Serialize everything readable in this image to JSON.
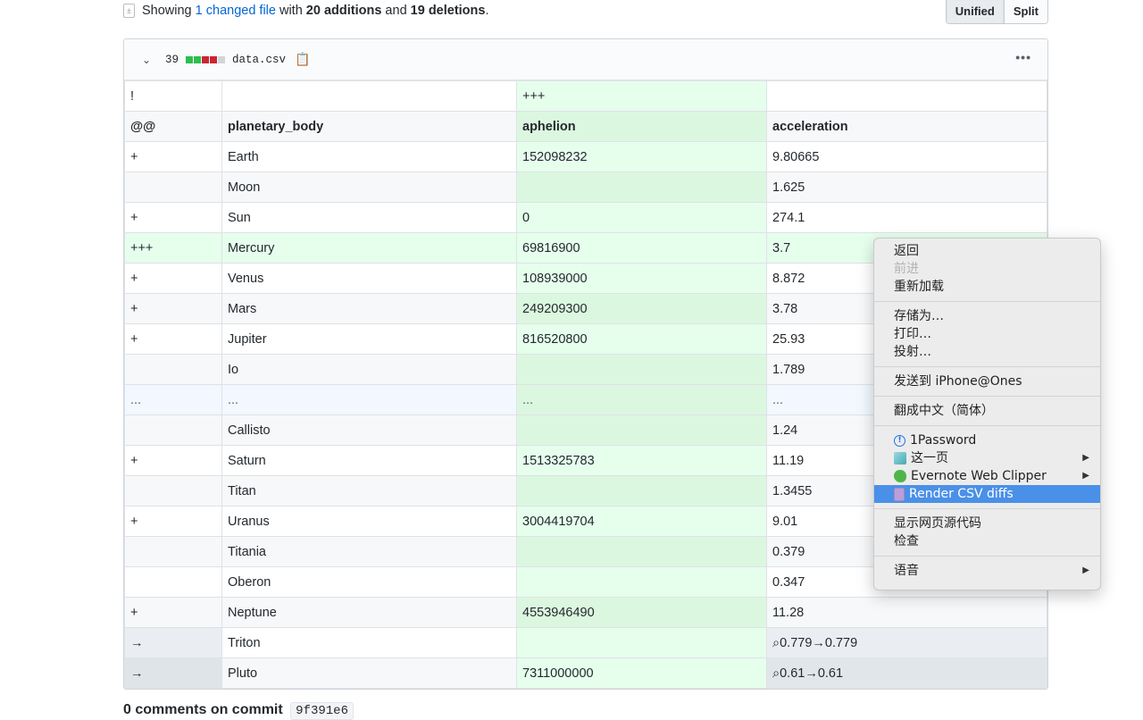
{
  "toc": {
    "showing": "Showing ",
    "changed_files_link": "1 changed file",
    "with": " with ",
    "additions": "20 additions",
    "and": " and ",
    "deletions": "19 deletions",
    "period": "."
  },
  "view_toggle": {
    "unified": "Unified",
    "split": "Split",
    "selected": "Unified"
  },
  "file": {
    "change_count": "39",
    "diffstat": [
      "added",
      "added",
      "deleted",
      "deleted",
      "neutral"
    ],
    "diffstat_colors": {
      "added": "#2cbe4e",
      "deleted": "#cb2431",
      "neutral": "#d1d5da"
    },
    "name": "data.csv",
    "more_label": "•••"
  },
  "table": {
    "added_column_index": 2,
    "rows": [
      {
        "type": "odd",
        "cells": [
          "!",
          "",
          "+++",
          ""
        ]
      },
      {
        "type": "hdr",
        "cells": [
          "@@",
          "planetary_body",
          "aphelion",
          "acceleration"
        ]
      },
      {
        "type": "odd",
        "cells": [
          "+",
          "Earth",
          "152098232",
          "9.80665"
        ]
      },
      {
        "type": "even",
        "cells": [
          "",
          "Moon",
          "",
          "1.625"
        ]
      },
      {
        "type": "odd",
        "cells": [
          "+",
          "Sun",
          "0",
          "274.1"
        ]
      },
      {
        "type": "added",
        "cells": [
          "+++",
          "Mercury",
          "69816900",
          "3.7"
        ]
      },
      {
        "type": "odd",
        "cells": [
          "+",
          "Venus",
          "108939000",
          "8.872"
        ]
      },
      {
        "type": "even",
        "cells": [
          "+",
          "Mars",
          "249209300",
          "3.78"
        ]
      },
      {
        "type": "odd",
        "cells": [
          "+",
          "Jupiter",
          "816520800",
          "25.93"
        ]
      },
      {
        "type": "even",
        "cells": [
          "",
          "Io",
          "",
          "1.789"
        ]
      },
      {
        "type": "spacer",
        "cells": [
          "...",
          "...",
          "...",
          "..."
        ]
      },
      {
        "type": "even",
        "cells": [
          "",
          "Callisto",
          "",
          "1.24"
        ]
      },
      {
        "type": "odd",
        "cells": [
          "+",
          "Saturn",
          "1513325783",
          "11.19"
        ]
      },
      {
        "type": "even",
        "cells": [
          "",
          "Titan",
          "",
          "1.3455"
        ]
      },
      {
        "type": "odd",
        "cells": [
          "+",
          "Uranus",
          "3004419704",
          "9.01"
        ]
      },
      {
        "type": "even",
        "cells": [
          "",
          "Titania",
          "",
          "0.379"
        ]
      },
      {
        "type": "odd",
        "cells": [
          "",
          "Oberon",
          "",
          "0.347"
        ]
      },
      {
        "type": "even",
        "cells": [
          "+",
          "Neptune",
          "4553946490",
          "11.28"
        ]
      },
      {
        "type": "modified",
        "cells": [
          "→",
          "Triton",
          "",
          "⌕0.779→0.779"
        ]
      },
      {
        "type": "modified2",
        "cells": [
          "→",
          "Pluto",
          "7311000000",
          "⌕0.61→0.61"
        ]
      }
    ]
  },
  "comments": {
    "title": "0 comments on commit",
    "sha": "9f391e6"
  },
  "context_menu": {
    "groups": [
      [
        {
          "label": "返回",
          "disabled": false
        },
        {
          "label": "前进",
          "disabled": true
        },
        {
          "label": "重新加载",
          "disabled": false
        }
      ],
      [
        {
          "label": "存储为…",
          "disabled": false
        },
        {
          "label": "打印…",
          "disabled": false
        },
        {
          "label": "投射…",
          "disabled": false
        }
      ],
      [
        {
          "label": "发送到 iPhone@Ones",
          "disabled": false
        }
      ],
      [
        {
          "label": "翻成中文（简体）",
          "disabled": false
        }
      ],
      [
        {
          "label": "1Password",
          "icon": "1password-icon",
          "disabled": false
        },
        {
          "label": "这一页",
          "icon": "cube-extension-icon",
          "submenu": true
        },
        {
          "label": "Evernote Web Clipper",
          "icon": "evernote-icon",
          "submenu": true
        },
        {
          "label": "Render CSV diffs",
          "icon": "csv-file-icon",
          "highlighted": true
        }
      ],
      [
        {
          "label": "显示网页源代码",
          "disabled": false
        },
        {
          "label": "检查",
          "disabled": false
        }
      ],
      [
        {
          "label": "语音",
          "submenu": true
        }
      ]
    ]
  }
}
